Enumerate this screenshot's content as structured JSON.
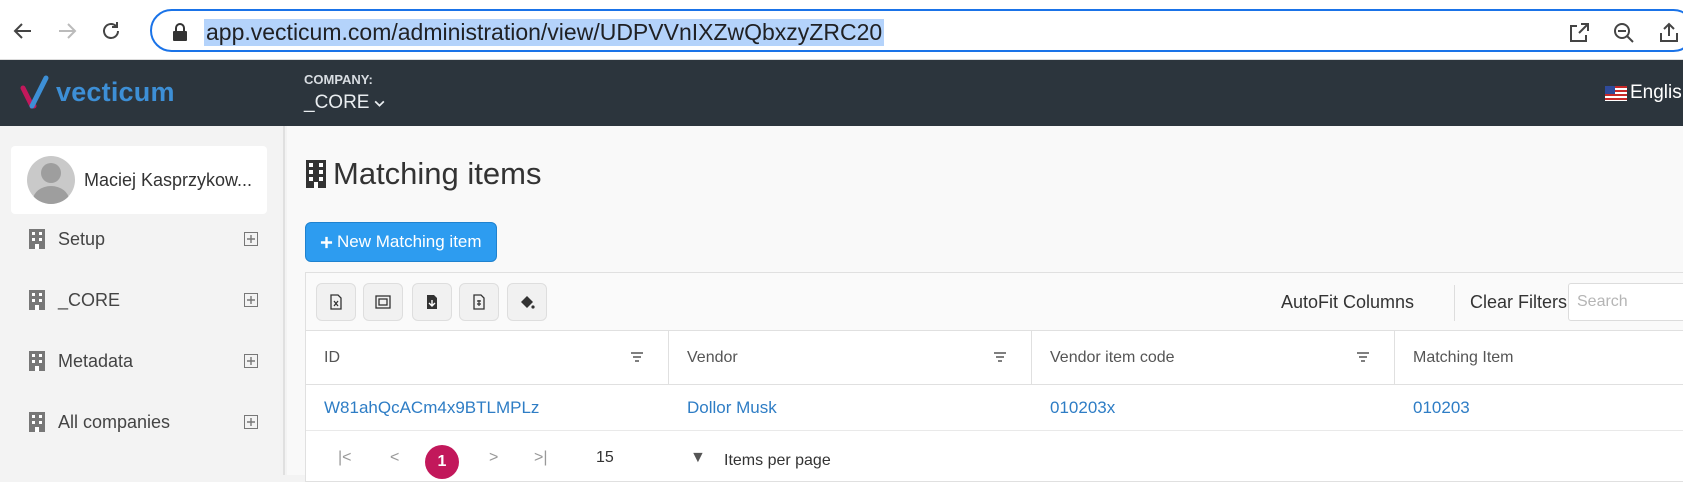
{
  "browser": {
    "url": "app.vecticum.com/administration/view/UDPVVnIXZwQbxzyZRC20"
  },
  "header": {
    "logo_text": "vecticum",
    "company_label": "COMPANY:",
    "company_value": "_CORE",
    "language": "English"
  },
  "sidebar": {
    "user_name": "Maciej Kasprzykow...",
    "items": [
      {
        "label": "Setup"
      },
      {
        "label": "_CORE"
      },
      {
        "label": "Metadata"
      },
      {
        "label": "All companies"
      }
    ]
  },
  "main": {
    "title": "Matching items",
    "new_button": "New Matching item",
    "toolbar": {
      "autofit": "AutoFit Columns",
      "clear_filters": "Clear Filters",
      "search_placeholder": "Search"
    },
    "columns": [
      "ID",
      "Vendor",
      "Vendor item code",
      "Matching Item"
    ],
    "rows": [
      {
        "id": "W81ahQcACm4x9BTLMPLz",
        "vendor": "Dollor Musk",
        "vendor_item_code": "010203x",
        "matching_item": "010203"
      }
    ],
    "pager": {
      "current_page": "1",
      "page_size": "15",
      "items_per_page_label": "Items per page"
    }
  },
  "colors": {
    "header_bg": "#2c353d",
    "accent": "#2d9cf0",
    "link": "#2e7dc5",
    "pager_active": "#c2185b"
  }
}
